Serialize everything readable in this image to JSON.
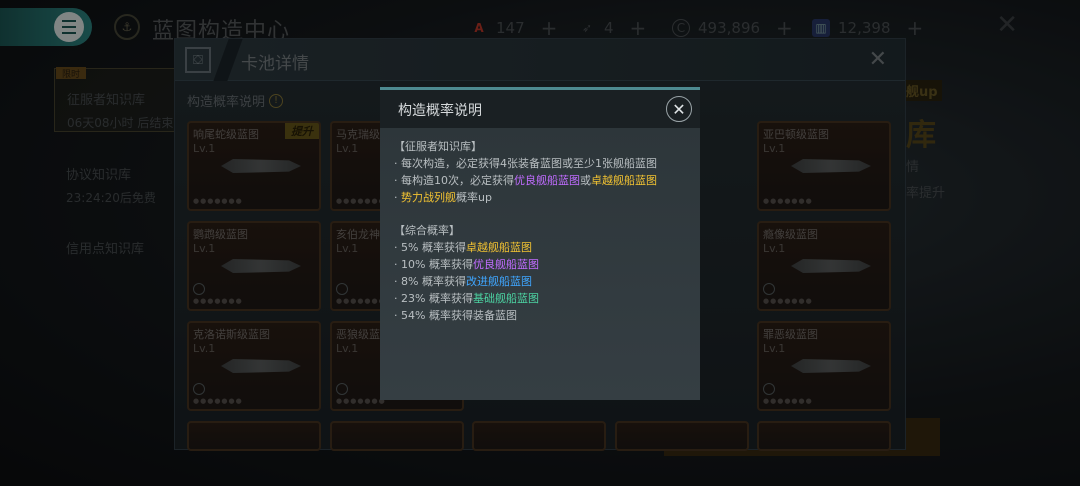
{
  "topbar": {
    "title": "蓝图构造中心",
    "resources": [
      {
        "icon": "fleet-token-icon",
        "value": "147",
        "color": "#c43a2a"
      },
      {
        "icon": "ship-part-icon",
        "value": "4",
        "color": "#9a9a9a"
      },
      {
        "icon": "credits-icon",
        "value": "493,896",
        "color": "#9a9a9a"
      },
      {
        "icon": "blueprint-token-icon",
        "value": "12,398",
        "color": "#3a5aa8"
      }
    ]
  },
  "sidebar": {
    "items": [
      {
        "title": "征服者知识库",
        "sub": "06天08小时 后结束",
        "badge": "限时"
      },
      {
        "title": "协议知识库",
        "sub": "23:24:20后免费"
      },
      {
        "title": "信用点知识库",
        "sub": ""
      }
    ]
  },
  "right_panel": {
    "up_label": "舰up",
    "big_char": "库",
    "line1": "情",
    "line2": "率提升"
  },
  "pool": {
    "title": "卡池详情",
    "rate_link": "构造概率说明",
    "cards": [
      {
        "name": "响尾蛇级蓝图",
        "lv": "Lv.1",
        "badge": "提升"
      },
      {
        "name": "马克瑞级",
        "lv": "Lv.1"
      },
      {
        "name": "亚巴顿级蓝图",
        "lv": "Lv.1"
      },
      {
        "name": "鹦鹉级蓝图",
        "lv": "Lv.1"
      },
      {
        "name": "亥伯龙神",
        "lv": "Lv.1"
      },
      {
        "name": "",
        "lv": ""
      },
      {
        "name": "瘾像级蓝图",
        "lv": "Lv.1"
      },
      {
        "name": "克洛诺斯级蓝图",
        "lv": "Lv.1"
      },
      {
        "name": "恶狼级蓝",
        "lv": "Lv.1"
      },
      {
        "name": "",
        "lv": ""
      },
      {
        "name": "罪恶级蓝图",
        "lv": "Lv.1"
      }
    ]
  },
  "modal": {
    "title": "构造概率说明",
    "section1_title": "【征服者知识库】",
    "s1_line1": "· 每次构造，必定获得4张装备蓝图或至少1张舰船蓝图",
    "s1_line2_pre": "· 每构造10次，必定获得",
    "s1_line2_a": "优良舰船蓝图",
    "s1_line2_mid": "或",
    "s1_line2_b": "卓越舰船蓝图",
    "s1_line3_a": "势力战列舰",
    "s1_line3_post": "概率up",
    "section2_title": "【综合概率】",
    "rates": [
      {
        "pre": "· 5% 概率获得",
        "hl": "卓越舰船蓝图",
        "cls": "c-gold"
      },
      {
        "pre": "· 10% 概率获得",
        "hl": "优良舰船蓝图",
        "cls": "c-purple"
      },
      {
        "pre": "· 8% 概率获得",
        "hl": "改进舰船蓝图",
        "cls": "c-blue"
      },
      {
        "pre": "· 23% 概率获得",
        "hl": "基础舰船蓝图",
        "cls": "c-green"
      },
      {
        "pre": "· 54% 概率获得装备蓝图",
        "hl": "",
        "cls": ""
      }
    ]
  },
  "colors": {
    "accent_teal": "#2e8a86",
    "gold": "#f1c232",
    "purple": "#c06cff",
    "blue": "#3fa6ff",
    "green": "#4cd3a2"
  }
}
